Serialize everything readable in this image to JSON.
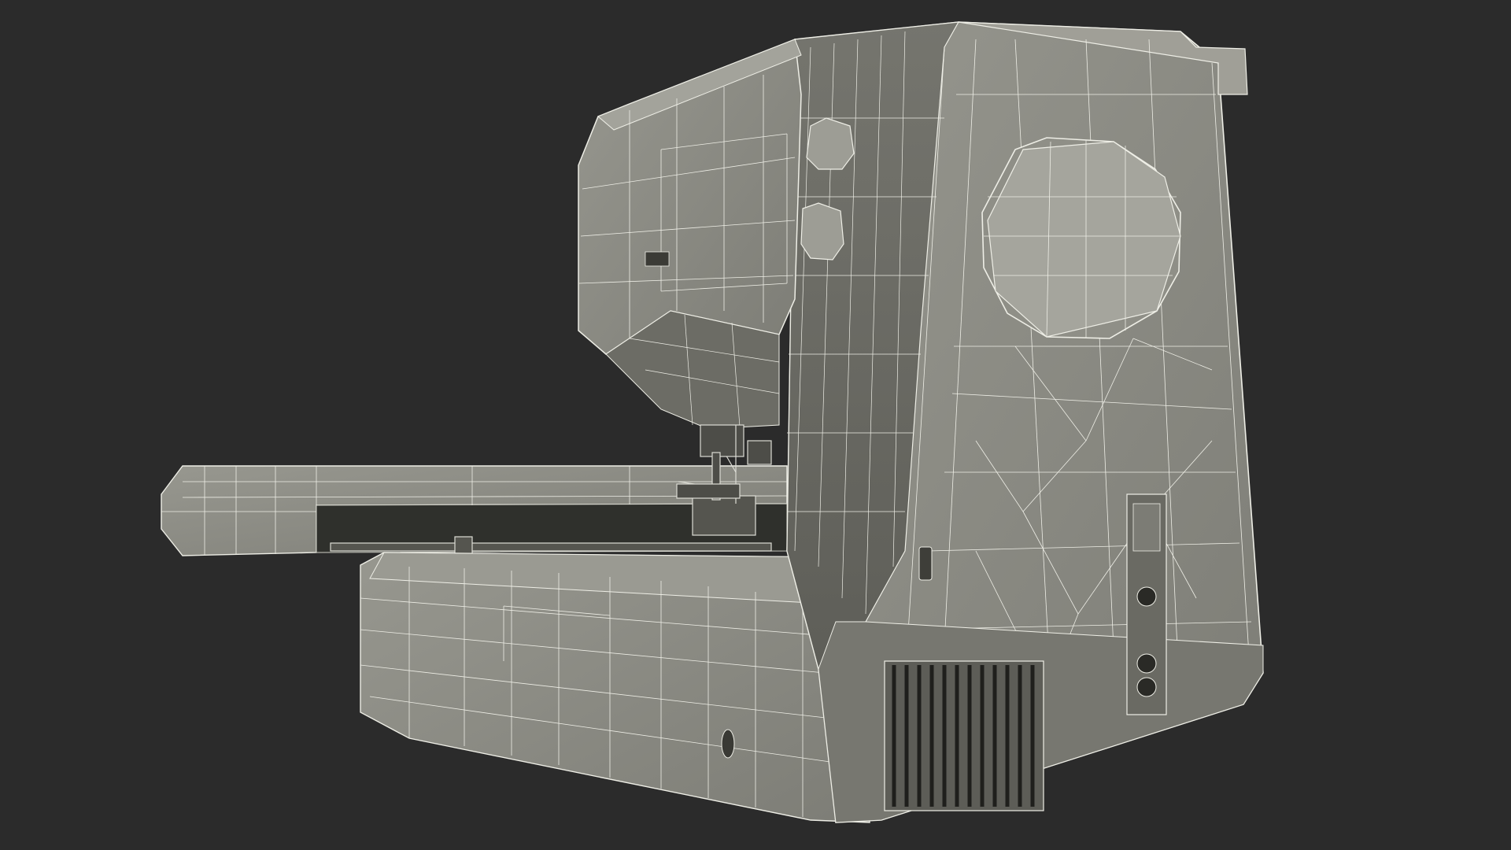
{
  "scene": {
    "subject": "embroidery-sewing-machine-wireframe",
    "background_color": "#2b2b2b",
    "body_color": "#8c8c84",
    "body_shade_color": "#6f6f68",
    "wire_color": "#f2f2ea",
    "icons": [
      "handwheel-icon",
      "dial-icon",
      "usb-port-icon",
      "power-socket-icon",
      "vent-grille-icon"
    ]
  }
}
